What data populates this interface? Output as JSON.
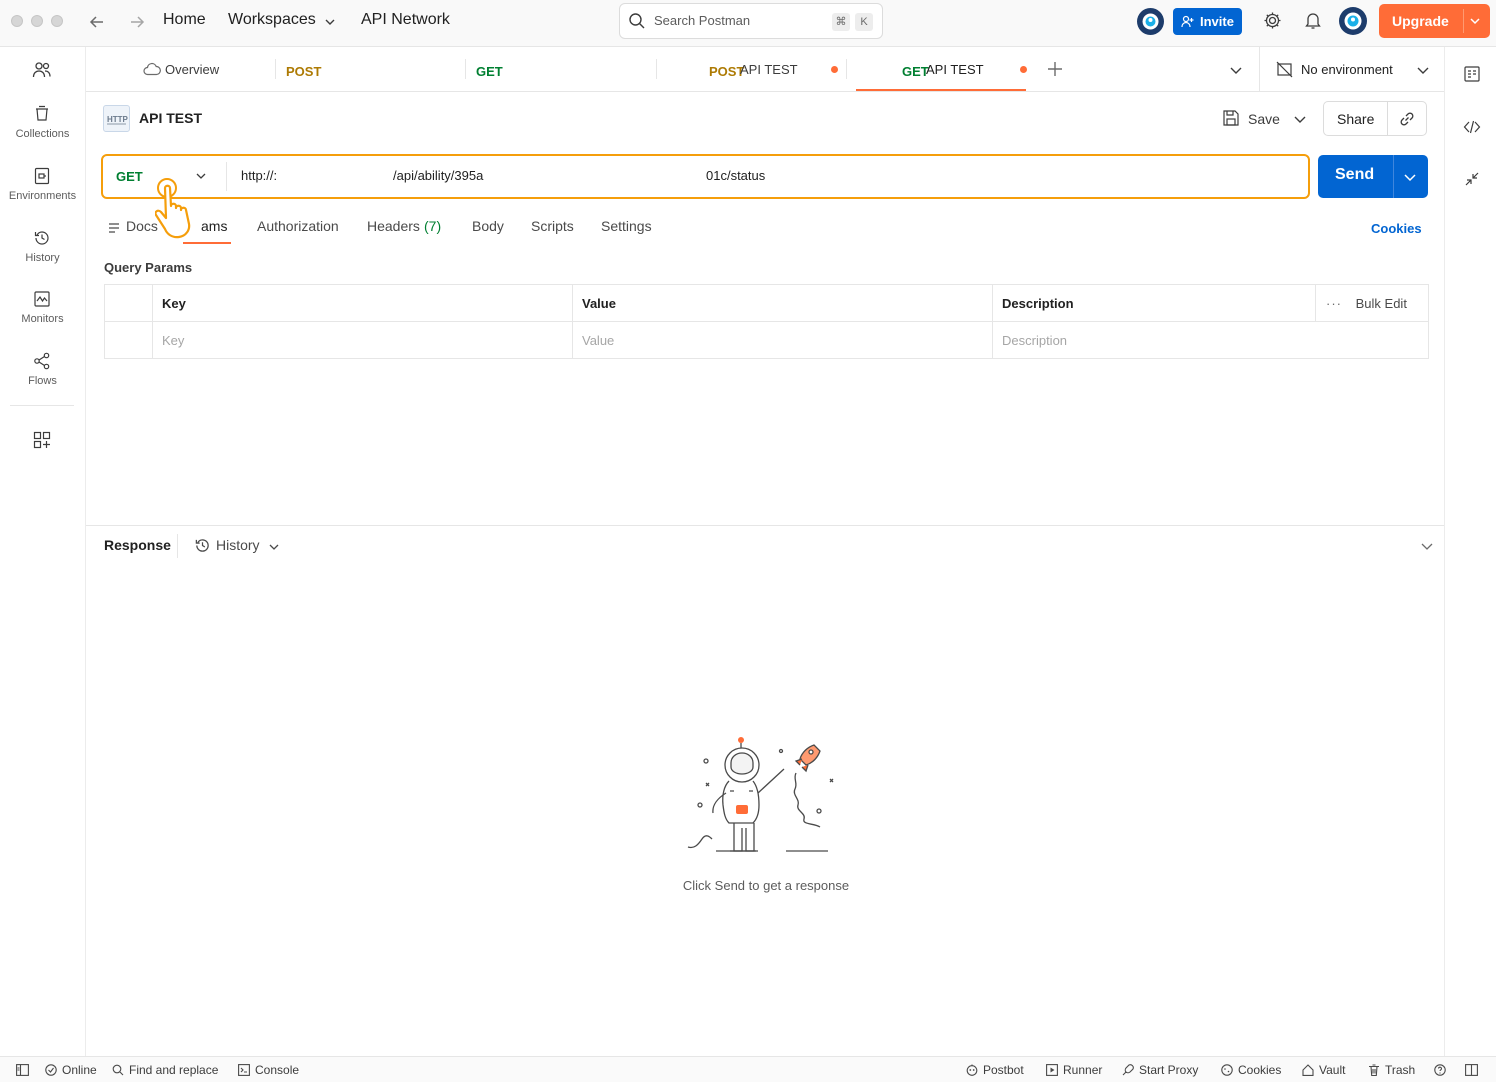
{
  "nav": {
    "home": "Home",
    "workspaces": "Workspaces",
    "api_network": "API Network"
  },
  "search": {
    "placeholder": "Search Postman",
    "shortcut_cmd": "⌘",
    "shortcut_key": "K"
  },
  "header": {
    "invite": "Invite",
    "upgrade": "Upgrade"
  },
  "sidebar": {
    "items": [
      {
        "label": "Collections"
      },
      {
        "label": "Environments"
      },
      {
        "label": "History"
      },
      {
        "label": "Monitors"
      },
      {
        "label": "Flows"
      }
    ]
  },
  "tabs": [
    {
      "method": "",
      "label": "Overview"
    },
    {
      "method": "POST",
      "label": ""
    },
    {
      "method": "GET",
      "label": ""
    },
    {
      "method": "POST",
      "label": "API TEST"
    },
    {
      "method": "GET",
      "label": "API TEST"
    }
  ],
  "environment": {
    "selected": "No environment"
  },
  "request": {
    "name": "API TEST",
    "save": "Save",
    "share": "Share",
    "method": "GET",
    "url_part1": "http://:",
    "url_part2": "/api/ability/395a",
    "url_part3": "01c/status",
    "send": "Send",
    "cookies": "Cookies",
    "tabs": {
      "docs": "Docs",
      "params": "ams",
      "authorization": "Authorization",
      "headers": "Headers",
      "headers_count": "(7)",
      "body": "Body",
      "scripts": "Scripts",
      "settings": "Settings"
    },
    "query_params_title": "Query Params",
    "table": {
      "headers": [
        "Key",
        "Value",
        "Description"
      ],
      "bulk_edit": "Bulk Edit",
      "placeholders": [
        "Key",
        "Value",
        "Description"
      ]
    }
  },
  "response": {
    "title": "Response",
    "history": "History",
    "empty_message": "Click Send to get a response"
  },
  "statusbar": {
    "online": "Online",
    "find_replace": "Find and replace",
    "console": "Console",
    "postbot": "Postbot",
    "runner": "Runner",
    "start_proxy": "Start Proxy",
    "cookies": "Cookies",
    "vault": "Vault",
    "trash": "Trash"
  },
  "colors": {
    "get": "#007f31",
    "post": "#ad7a03",
    "accent": "#ff6c37",
    "send": "#0265d2",
    "highlight": "#f59e0b"
  }
}
